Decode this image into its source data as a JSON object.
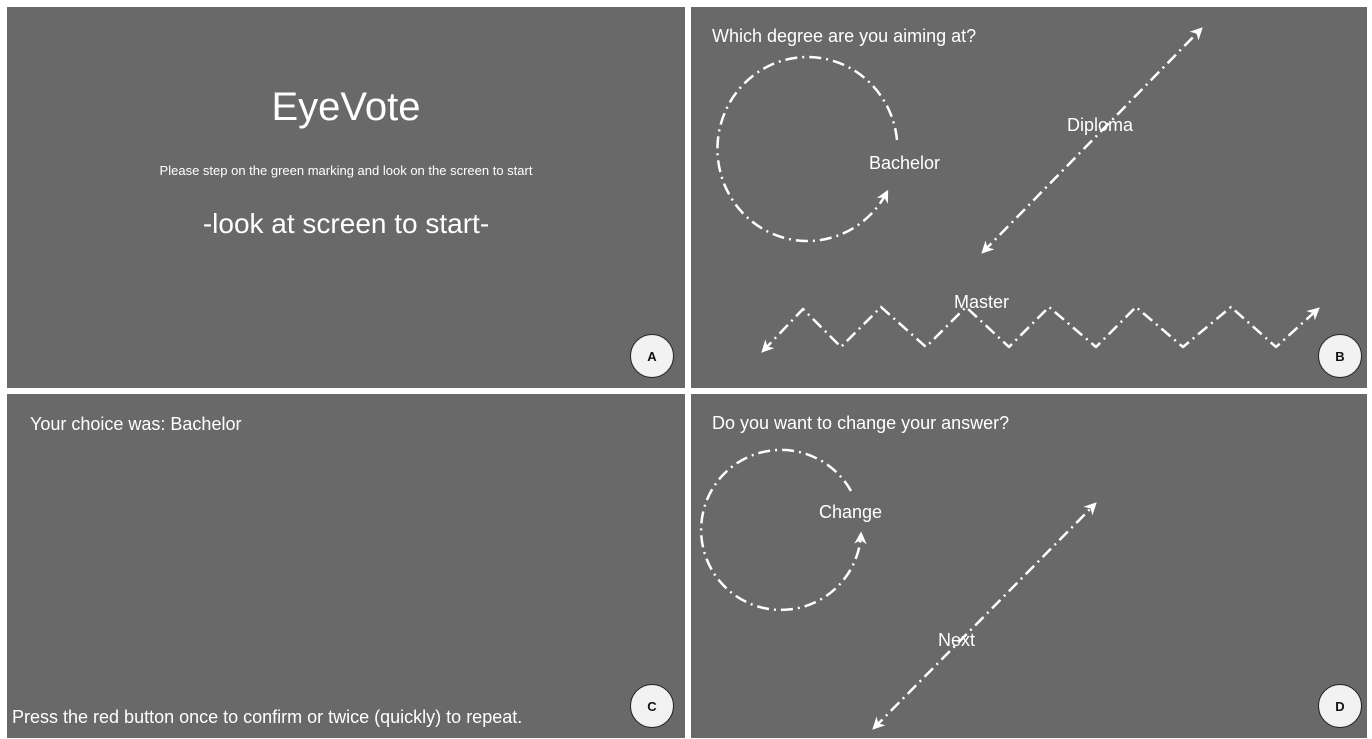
{
  "panel_a": {
    "title": "EyeVote",
    "instruction": "Please step on the green marking and look on the screen to start",
    "prompt": "-look at screen to start-",
    "badge": "A"
  },
  "panel_b": {
    "question": "Which degree are you aiming at?",
    "options": {
      "circle": "Bachelor",
      "diagonal": "Diploma",
      "zigzag": "Master"
    },
    "badge": "B"
  },
  "panel_c": {
    "choice_text": "Your choice was: Bachelor",
    "confirm_text": "Press the red button once to confirm or twice (quickly) to repeat.",
    "badge": "C"
  },
  "panel_d": {
    "question": "Do you want to change your answer?",
    "options": {
      "circle": "Change",
      "diagonal": "Next"
    },
    "badge": "D"
  },
  "colors": {
    "panel_background": "#696969",
    "text": "#ffffff",
    "badge_fill": "#f2f2f2"
  }
}
